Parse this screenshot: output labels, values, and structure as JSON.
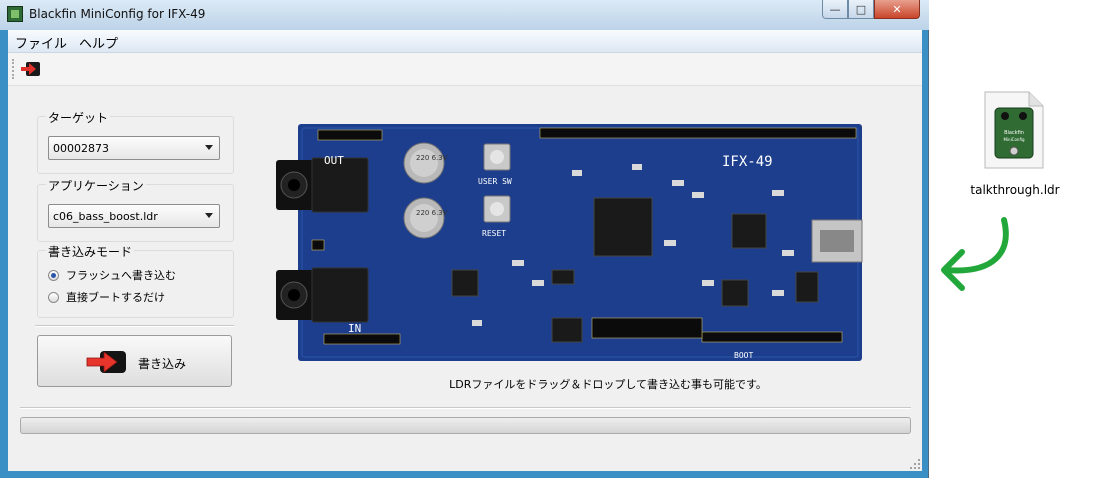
{
  "window": {
    "title": "Blackfin MiniConfig for IFX-49",
    "caption_buttons": {
      "minimize": "—",
      "maximize": "□",
      "close": "✕"
    }
  },
  "menubar": {
    "items": [
      "ファイル",
      "ヘルプ"
    ]
  },
  "toolbar": {
    "write_icon": "red-arrow-icon"
  },
  "target_group": {
    "label": "ターゲット",
    "selected": "00002873"
  },
  "app_group": {
    "label": "アプリケーション",
    "selected": "c06_bass_boost.ldr"
  },
  "mode_group": {
    "label": "書き込みモード",
    "options": [
      {
        "label": "フラッシュへ書き込む",
        "checked": true
      },
      {
        "label": "直接ブートするだけ",
        "checked": false
      }
    ]
  },
  "write_button": {
    "label": "書き込み",
    "icon": "red-arrow-icon"
  },
  "board": {
    "silkscreen": {
      "name": "IFX-49",
      "out": "OUT",
      "in": "IN",
      "user_sw": "USER SW",
      "reset": "RESET",
      "boot": "BOOT",
      "cap1": "220 6.3V",
      "cap2": "220 6.3V"
    },
    "colors": {
      "pcb": "#1c3e8c",
      "silk": "#ffffff"
    }
  },
  "hint": "LDRファイルをドラッグ＆ドロップして書き込む事も可能です。",
  "progress": 0,
  "desktop_file": {
    "name": "talkthrough.ldr",
    "icon_text": "Blackfin MiniConfig"
  },
  "drop_arrow": {
    "color": "#22a83a"
  }
}
